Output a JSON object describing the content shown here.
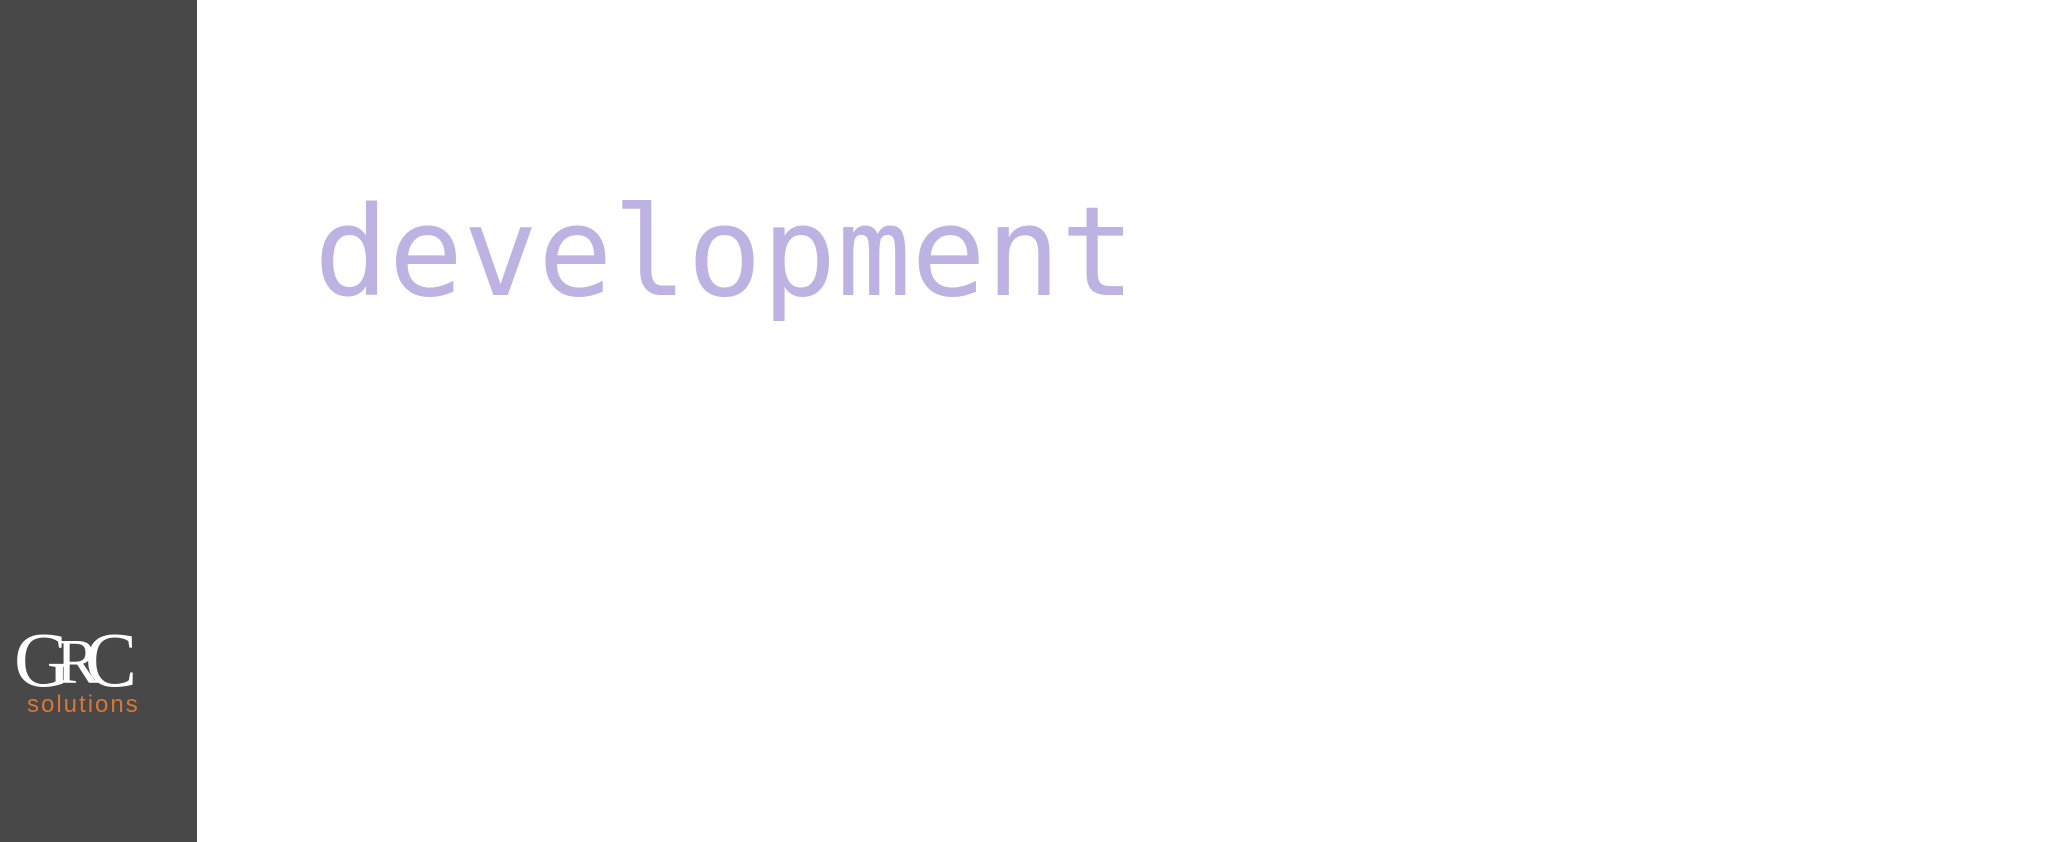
{
  "brand": {
    "logo_text": "GRC",
    "logo_subtitle": "solutions",
    "sidebar_color": "#484848",
    "logo_accent_color": "#d8763a"
  },
  "main": {
    "headline": "development",
    "headline_color": "#beb2e2"
  }
}
